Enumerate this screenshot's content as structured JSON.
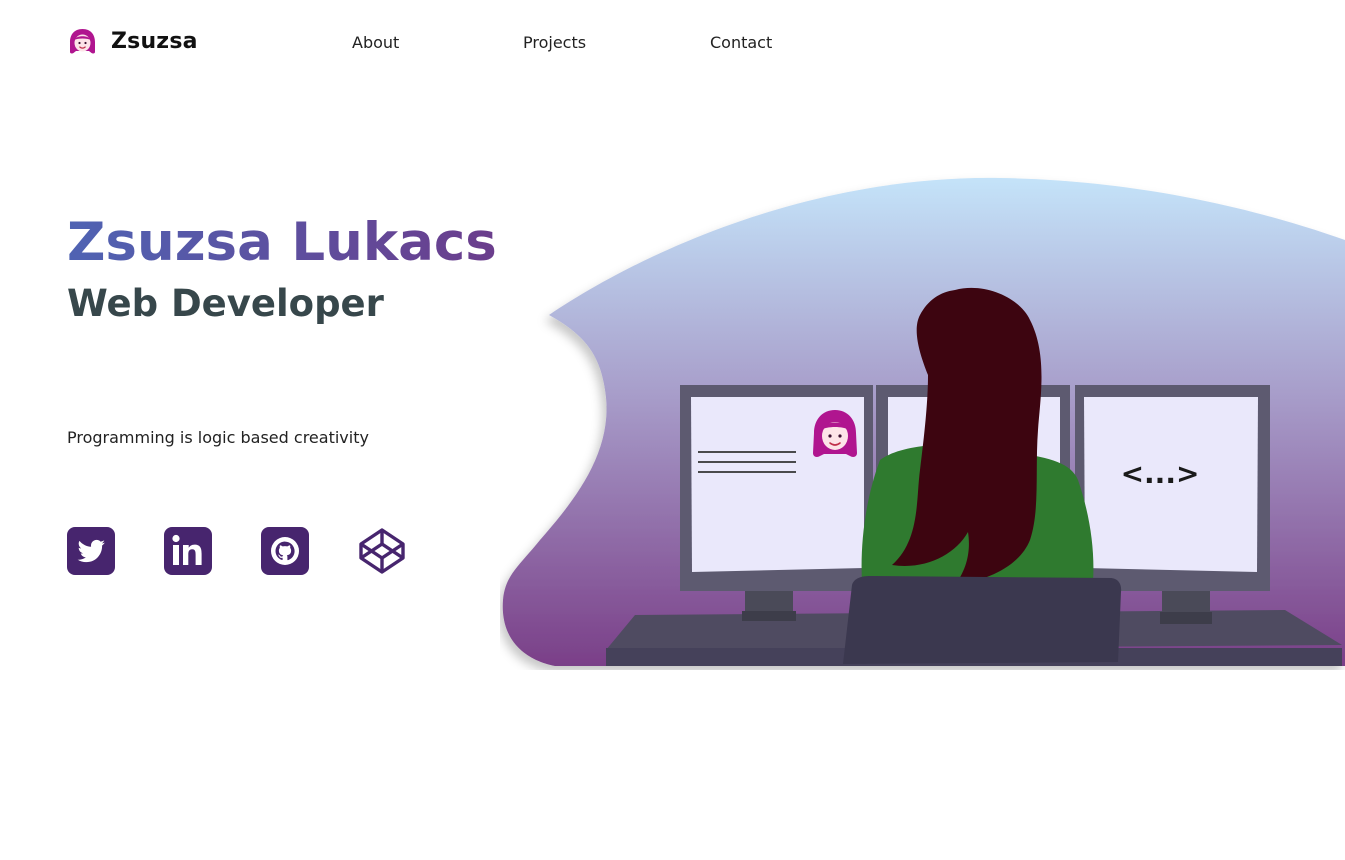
{
  "header": {
    "brand": "Zsuzsa",
    "brand_icon": "woman-face-icon",
    "nav": [
      {
        "label": "About"
      },
      {
        "label": "Projects"
      },
      {
        "label": "Contact"
      }
    ]
  },
  "hero": {
    "name": "Zsuzsa Lukacs",
    "role": "Web Developer",
    "tagline": "Programming is logic based creativity"
  },
  "social": [
    {
      "name": "twitter",
      "icon": "twitter-icon"
    },
    {
      "name": "linkedin",
      "icon": "linkedin-icon"
    },
    {
      "name": "github",
      "icon": "github-icon"
    },
    {
      "name": "codepen",
      "icon": "codepen-icon"
    }
  ],
  "illustration": {
    "monitor_code_text": "<...>",
    "icon": "woman-at-desk-illustration"
  },
  "colors": {
    "accent_purple": "#47256e",
    "name_gradient_start": "#4f63b3",
    "name_gradient_end": "#6b3d8c",
    "role_text": "#37474b",
    "blob_top": "#c4e3f9",
    "blob_bottom": "#7a3f88",
    "brand_icon_pink": "#b0158f",
    "hair": "#3d0510",
    "sweater": "#2f7a2f"
  }
}
